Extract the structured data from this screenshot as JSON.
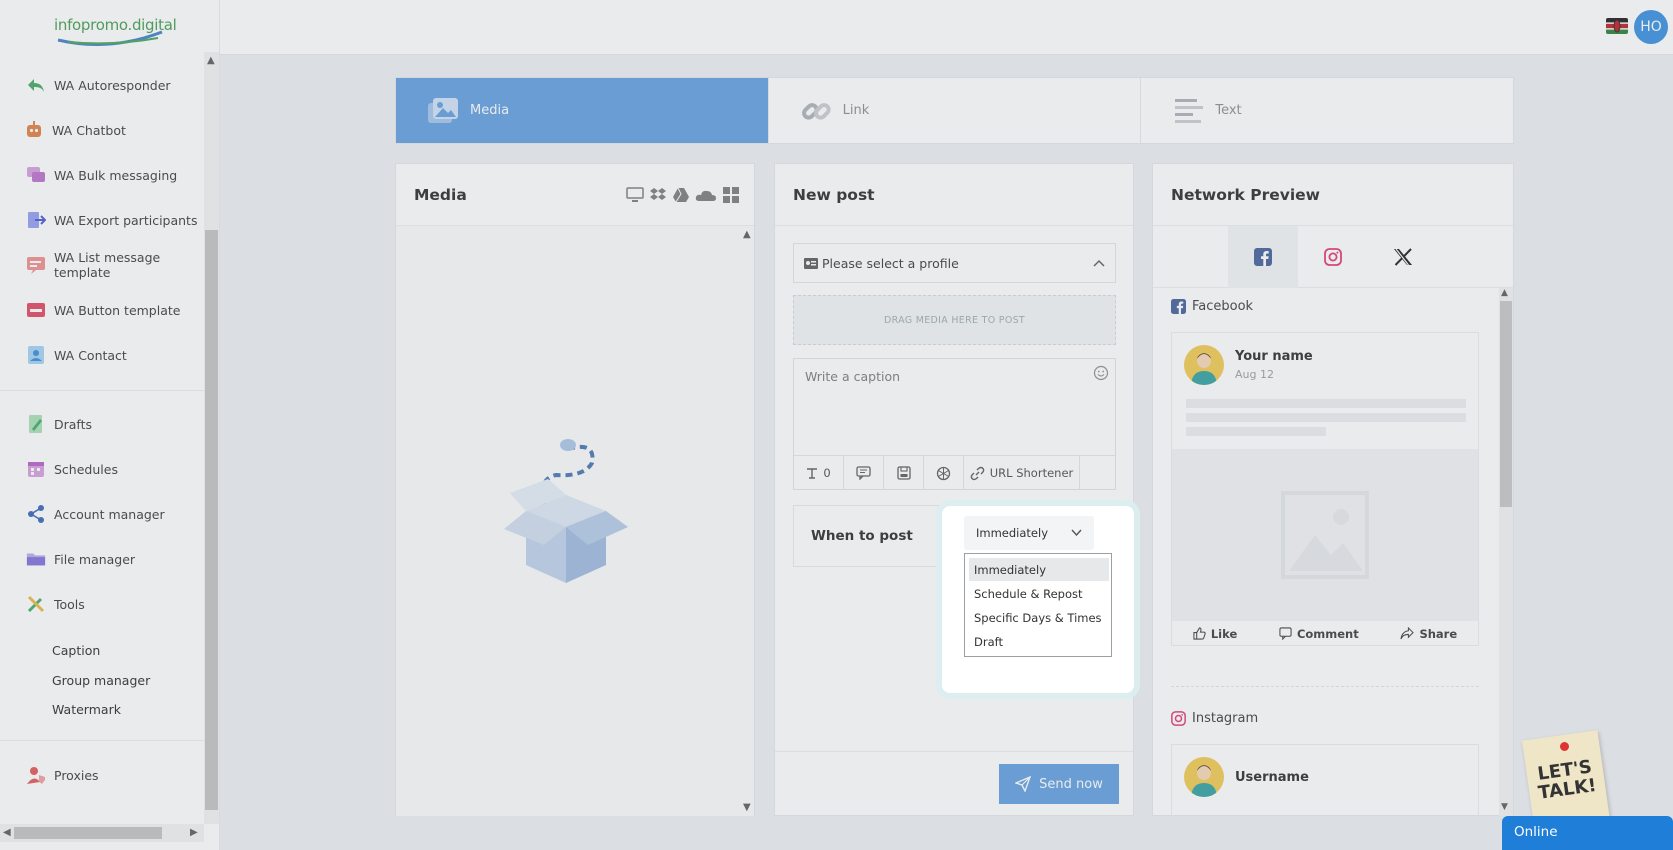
{
  "app": {
    "logo_text": "infopromo.digital",
    "user_initials": "HO"
  },
  "sidebar": {
    "items": [
      {
        "label": "WA Autoresponder",
        "icon": "reply-icon",
        "color": "#3da35d"
      },
      {
        "label": "WA Chatbot",
        "icon": "robot-icon",
        "color": "#e07a3a"
      },
      {
        "label": "WA Bulk messaging",
        "icon": "chat-bubbles-icon",
        "color": "#b86cc9"
      },
      {
        "label": "WA Export participants",
        "icon": "export-icon",
        "color": "#5b6ee0"
      },
      {
        "label": "WA List message template",
        "icon": "list-message-icon",
        "color": "#e86a6a"
      },
      {
        "label": "WA Button template",
        "icon": "button-template-icon",
        "color": "#e0405a"
      },
      {
        "label": "WA Contact",
        "icon": "contact-icon",
        "color": "#4aa3e0"
      }
    ],
    "items2": [
      {
        "label": "Drafts",
        "icon": "pencil-file-icon",
        "color": "#3aa85e"
      },
      {
        "label": "Schedules",
        "icon": "calendar-icon",
        "color": "#c05ac9"
      },
      {
        "label": "Account manager",
        "icon": "share-nodes-icon",
        "color": "#2f5fb8"
      },
      {
        "label": "File manager",
        "icon": "folder-icon",
        "color": "#7a6ad9"
      },
      {
        "label": "Tools",
        "icon": "tools-icon",
        "color": "#3aa85e"
      }
    ],
    "tools_sub": [
      "Caption",
      "Group manager",
      "Watermark"
    ],
    "proxies": {
      "label": "Proxies",
      "icon": "user-shield-icon",
      "color": "#e05050"
    }
  },
  "tabs": [
    {
      "label": "Media",
      "icon": "image-icon",
      "active": true
    },
    {
      "label": "Link",
      "icon": "link-icon",
      "active": false
    },
    {
      "label": "Text",
      "icon": "text-lines-icon",
      "active": false
    }
  ],
  "media_card": {
    "title": "Media"
  },
  "newpost": {
    "title": "New post",
    "profile_placeholder": "Please select a profile",
    "drop_text": "DRAG MEDIA HERE TO POST",
    "caption_placeholder": "Write a caption",
    "count": "0",
    "url_shortener": "URL Shortener",
    "when_label": "When to post",
    "when_selected": "Immediately",
    "when_options": [
      "Immediately",
      "Schedule & Repost",
      "Specific Days & Times",
      "Draft"
    ],
    "send_label": "Send now"
  },
  "preview": {
    "title": "Network Preview",
    "networks": [
      "facebook-icon",
      "instagram-icon",
      "x-icon"
    ],
    "facebook": {
      "label": "Facebook",
      "name": "Your name",
      "date": "Aug 12",
      "like": "Like",
      "comment": "Comment",
      "share": "Share"
    },
    "instagram": {
      "label": "Instagram",
      "name": "Username"
    }
  },
  "chat": {
    "letstalk": "LET'S TALK!",
    "status": "Online"
  },
  "colors": {
    "accent": "#5a9be0",
    "facebook": "#3b5998",
    "instagram": "#e1306c",
    "online": "#1e7ed8"
  }
}
